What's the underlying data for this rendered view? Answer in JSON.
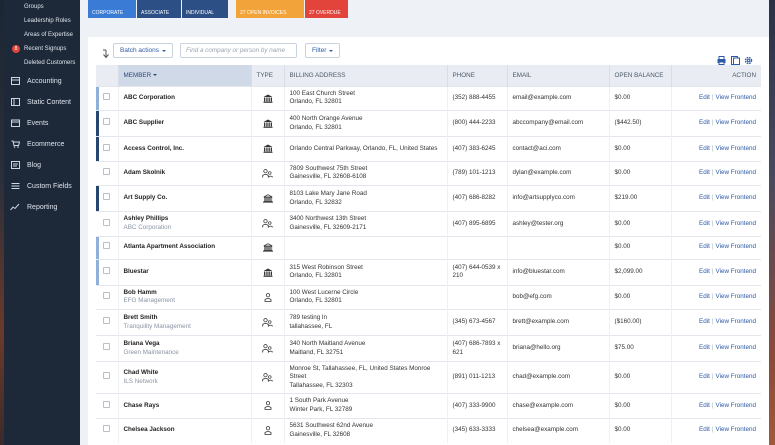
{
  "sidebar": {
    "subitems": [
      "Groups",
      "Leadership Roles",
      "Areas of Expertise",
      "Recent Signups",
      "Deleted Customers"
    ],
    "recent_signups_badge": "8",
    "items": [
      {
        "label": "Accounting",
        "icon": "accounting-icon"
      },
      {
        "label": "Static Content",
        "icon": "static-content-icon"
      },
      {
        "label": "Events",
        "icon": "events-icon"
      },
      {
        "label": "Ecommerce",
        "icon": "ecommerce-icon"
      },
      {
        "label": "Blog",
        "icon": "blog-icon"
      },
      {
        "label": "Custom Fields",
        "icon": "custom-fields-icon"
      },
      {
        "label": "Reporting",
        "icon": "reporting-icon"
      }
    ]
  },
  "stats": [
    {
      "label": "CORPORATE",
      "color": "#3a7bd5"
    },
    {
      "label": "ASSOCIATE",
      "color": "#2c4f86"
    },
    {
      "label": "INDIVIDUAL",
      "color": "#2c4f86"
    },
    {
      "label": "27 OPEN INVOICES",
      "color": "#f2a33a"
    },
    {
      "label": "27 OVERDUE",
      "color": "#e2433a"
    }
  ],
  "toolbar": {
    "batch_actions": "Batch actions",
    "search_placeholder": "Find a company or person by name",
    "filter": "Filter"
  },
  "table": {
    "columns": {
      "member": "MEMBER",
      "type": "TYPE",
      "billing": "BILLING ADDRESS",
      "phone": "PHONE",
      "email": "EMAIL",
      "balance": "OPEN BALANCE",
      "action": "ACTION"
    },
    "edit_label": "Edit",
    "view_label": "View Frontend",
    "rows": [
      {
        "name": "ABC Corporation",
        "sub": "",
        "type": "company",
        "addr1": "100 East Church Street",
        "addr2": "Orlando, FL 32801",
        "phone1": "(352) 888-4455",
        "phone2": "",
        "email": "email@example.com",
        "balance": "$0.00"
      },
      {
        "name": "ABC Supplier",
        "sub": "",
        "type": "company",
        "addr1": "400 North Orange Avenue",
        "addr2": "Orlando, FL 32801",
        "phone1": "(800) 444-2233",
        "phone2": "",
        "email": "abccompany@email.com",
        "balance": "($442.50)"
      },
      {
        "name": "Access Control, Inc.",
        "sub": "",
        "type": "company",
        "addr1": "Orlando Central Parkway, Orlando, FL, United States",
        "addr2": "",
        "phone1": "(407) 383-6245",
        "phone2": "",
        "email": "contact@aci.com",
        "balance": "$0.00"
      },
      {
        "name": "Adam Skolnik",
        "sub": "",
        "type": "people",
        "addr1": "7809 Southwest 75th Street",
        "addr2": "Gainesville, FL 32608-6108",
        "phone1": "(789) 101-1213",
        "phone2": "",
        "email": "dylan@example.com",
        "balance": "$0.00"
      },
      {
        "name": "Art Supply Co.",
        "sub": "",
        "type": "company-outline",
        "addr1": "8103 Lake Mary Jane Road",
        "addr2": "Orlando, FL 32832",
        "phone1": "(407) 686-8282",
        "phone2": "",
        "email": "info@artsupplyco.com",
        "balance": "$219.00"
      },
      {
        "name": "Ashley Phillips",
        "sub": "ABC Corporation",
        "type": "people",
        "addr1": "3400 Northwest 13th Street",
        "addr2": "Gainesville, FL 32609-2171",
        "phone1": "(407) 895-6895",
        "phone2": "",
        "email": "ashley@tester.org",
        "balance": "$0.00"
      },
      {
        "name": "Atlanta Apartment Association",
        "sub": "",
        "type": "company-outline",
        "addr1": "",
        "addr2": "",
        "phone1": "",
        "phone2": "",
        "email": "",
        "balance": "$0.00"
      },
      {
        "name": "Bluestar",
        "sub": "",
        "type": "company",
        "addr1": "315 West Robinson Street",
        "addr2": "Orlando, FL 32801",
        "phone1": "(407) 644-0539 x",
        "phone2": "210",
        "email": "info@bluestar.com",
        "balance": "$2,099.00"
      },
      {
        "name": "Bob Hamm",
        "sub": "EFG Management",
        "type": "person",
        "addr1": "100 West Lucerne Circle",
        "addr2": "Orlando, FL 32801",
        "phone1": "",
        "phone2": "",
        "email": "bob@efg.com",
        "balance": "$0.00"
      },
      {
        "name": "Brett Smith",
        "sub": "Tranquility Management",
        "type": "people",
        "addr1": "789 testing ln",
        "addr2": "tallahassee, FL",
        "phone1": "(345) 673-4567",
        "phone2": "",
        "email": "brett@example.com",
        "balance": "($160.00)"
      },
      {
        "name": "Briana Vega",
        "sub": "Green Maintenance",
        "type": "people",
        "addr1": "340 North Maitland Avenue",
        "addr2": "Maitland, FL 32751",
        "phone1": "(407) 686-7893 x",
        "phone2": "621",
        "email": "briana@hello.org",
        "balance": "$75.00"
      },
      {
        "name": "Chad White",
        "sub": "ILS Network",
        "type": "people",
        "addr1": "Monroe St, Tallahassee, FL, United States Monroe Street",
        "addr2": "Tallahassee, FL 32303",
        "phone1": "(891) 011-1213",
        "phone2": "",
        "email": "chad@example.com",
        "balance": "$0.00"
      },
      {
        "name": "Chase Rays",
        "sub": "",
        "type": "person",
        "addr1": "1 South Park Avenue",
        "addr2": "Winter Park, FL 32789",
        "phone1": "(407) 333-9900",
        "phone2": "",
        "email": "chase@example.com",
        "balance": "$0.00"
      },
      {
        "name": "Chelsea Jackson",
        "sub": "",
        "type": "person",
        "addr1": "5631 Southwest 62nd Avenue",
        "addr2": "Gainesville, FL 32608",
        "phone1": "(345) 633-3333",
        "phone2": "",
        "email": "chelsea@example.com",
        "balance": "$0.00"
      }
    ]
  }
}
